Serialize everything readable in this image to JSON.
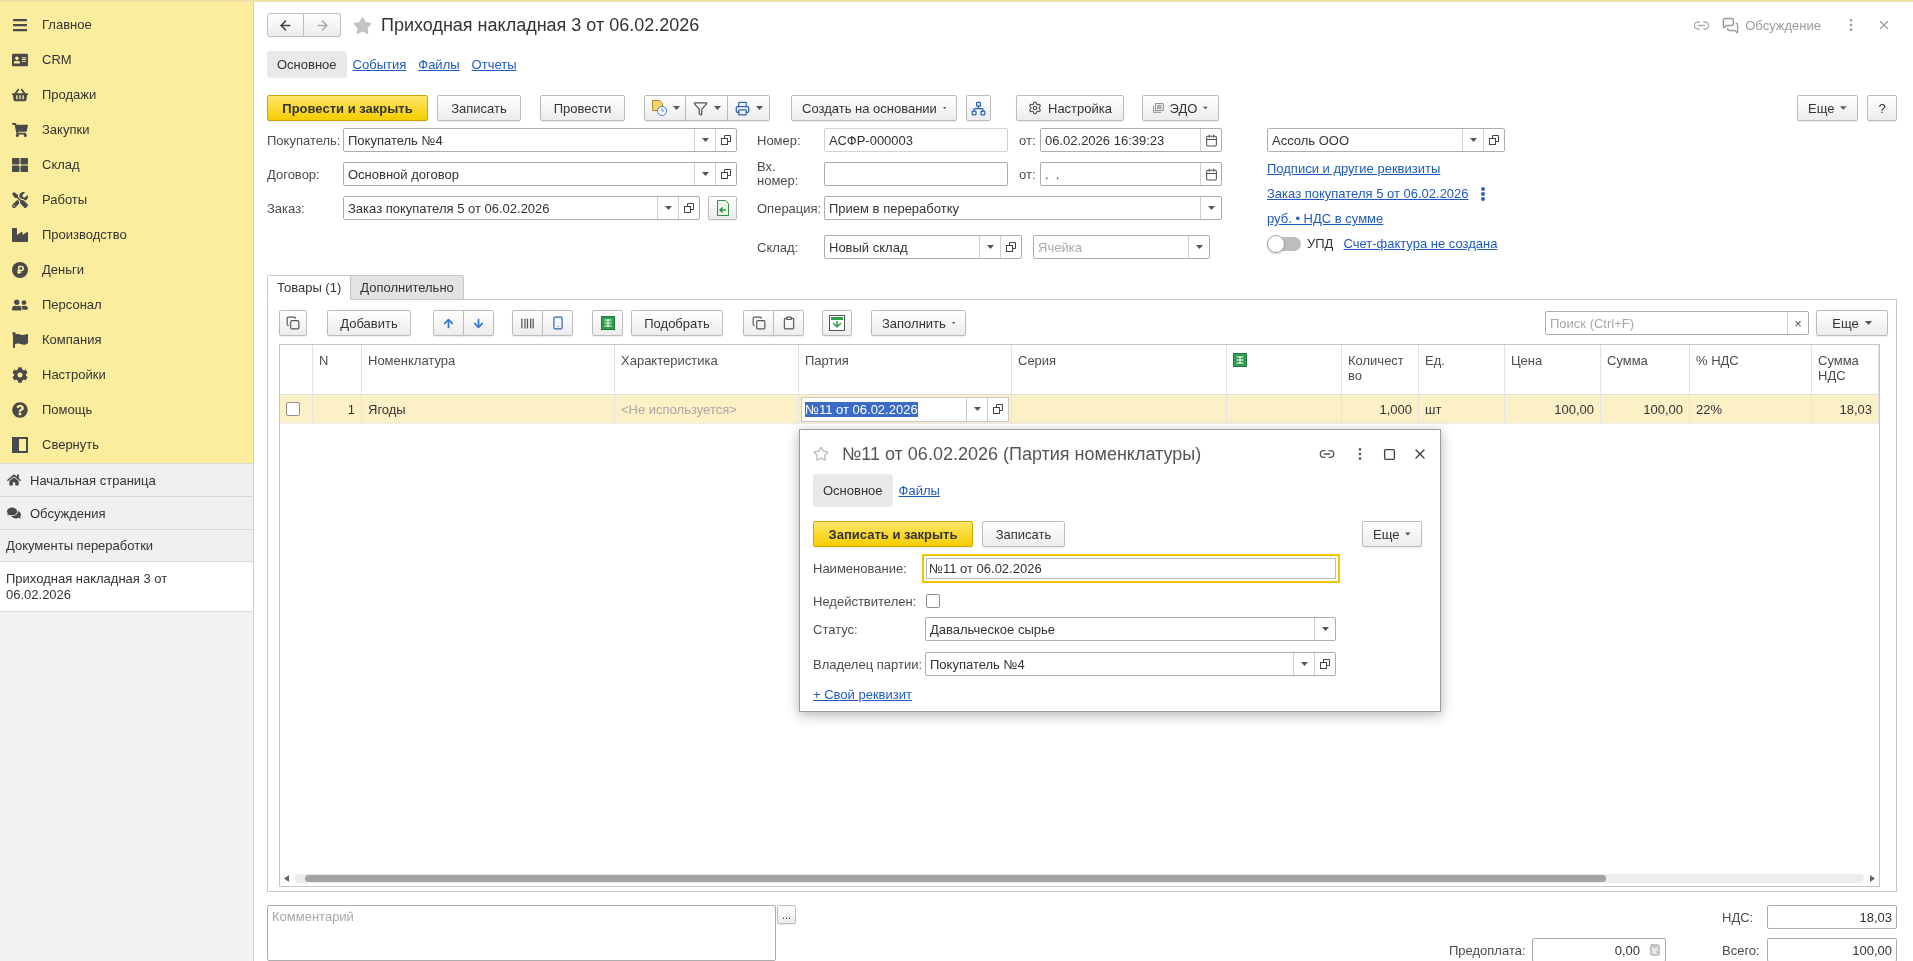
{
  "sidebar": {
    "sections": [
      {
        "label": "Главное"
      },
      {
        "label": "CRM"
      },
      {
        "label": "Продажи"
      },
      {
        "label": "Закупки"
      },
      {
        "label": "Склад"
      },
      {
        "label": "Работы"
      },
      {
        "label": "Производство"
      },
      {
        "label": "Деньги"
      },
      {
        "label": "Персонал"
      },
      {
        "label": "Компания"
      },
      {
        "label": "Настройки"
      },
      {
        "label": "Помощь"
      },
      {
        "label": "Свернуть"
      }
    ],
    "nav": [
      {
        "label": "Начальная страница"
      },
      {
        "label": "Обсуждения"
      }
    ],
    "open_windows": {
      "title": "Документы переработки",
      "items": [
        {
          "label": "Приходная накладная 3 от 06.02.2026",
          "selected": true
        }
      ]
    }
  },
  "document": {
    "title": "Приходная накладная 3 от 06.02.2026",
    "discussion": "Обсуждение",
    "tabs": [
      {
        "label": "Основное",
        "selected": true
      },
      {
        "label": "События",
        "selected": false
      },
      {
        "label": "Файлы",
        "selected": false
      },
      {
        "label": "Отчеты",
        "selected": false
      }
    ],
    "toolbar": {
      "post_and_close": "Провести и закрыть",
      "save": "Записать",
      "post": "Провести",
      "create_based_on": "Создать на основании",
      "settings": "Настройка",
      "edo": "ЭДО",
      "more": "Еще",
      "help": "?"
    },
    "fields": {
      "customer": {
        "label": "Покупатель:",
        "value": "Покупатель №4"
      },
      "contract": {
        "label": "Договор:",
        "value": "Основной договор"
      },
      "order": {
        "label": "Заказ:",
        "value": "Заказ покупателя 5 от 06.02.2026"
      },
      "number": {
        "label": "Номер:",
        "value": "АСФР-000003",
        "date_label": "от:",
        "date": "06.02.2026 16:39:23"
      },
      "incoming_number": {
        "label": "Вх. номер:",
        "date_label": "от:",
        "date": ".  ."
      },
      "operation": {
        "label": "Операция:",
        "value": "Прием в переработку"
      },
      "warehouse": {
        "label": "Склад:",
        "value": "Новый склад",
        "cell_placeholder": "Ячейка"
      },
      "organization": {
        "value": "Ассоль ООО"
      }
    },
    "links": {
      "signatures": "Подписи и другие реквизиты",
      "order": "Заказ покупателя 5 от 06.02.2026",
      "currency": "руб. • НДС в сумме"
    },
    "upd": {
      "label": "УПД",
      "on": false,
      "invoice_link": "Счет-фактура не создана"
    }
  },
  "goods": {
    "tabs": [
      {
        "label": "Товары (1)",
        "selected": true
      },
      {
        "label": "Дополнительно",
        "selected": false
      }
    ],
    "toolbar": {
      "add": "Добавить",
      "pick": "Подобрать",
      "fill": "Заполнить",
      "search_placeholder": "Поиск (Ctrl+F)",
      "clear": "×",
      "more": "Еще"
    },
    "columns": [
      {
        "label": "N",
        "kind": "number"
      },
      {
        "label": "Номенклатура",
        "kind": "text"
      },
      {
        "label": "Характеристика",
        "kind": "text"
      },
      {
        "label": "Партия",
        "kind": "text"
      },
      {
        "label": "Серия",
        "kind": "text"
      },
      {
        "kind": "icon"
      },
      {
        "label": "Количество",
        "kind": "number"
      },
      {
        "label": "Ед.",
        "kind": "text"
      },
      {
        "label": "Цена",
        "kind": "number"
      },
      {
        "label": "Сумма",
        "kind": "number"
      },
      {
        "label": "% НДС",
        "kind": "text"
      },
      {
        "label": "Сумма НДС",
        "kind": "number"
      }
    ],
    "rows": [
      {
        "selected": true,
        "checked": false,
        "cells": [
          "1",
          "Ягоды",
          {
            "text": "<Не используется>",
            "disabled": true
          },
          {
            "text": "№11 от 06.02.2026",
            "editing": true
          },
          null,
          null,
          "1,000",
          "шт",
          "100,00",
          "100,00",
          "22%",
          "18,03"
        ]
      }
    ]
  },
  "footer": {
    "comment_placeholder": "Комментарий",
    "comment_button": "...",
    "vat": {
      "label": "НДС:",
      "value": "18,03"
    },
    "prepayment": {
      "label": "Предоплата:",
      "value": "0,00"
    },
    "total": {
      "label": "Всего:",
      "value": "100,00"
    }
  },
  "batch_dialog": {
    "title": "№11 от 06.02.2026 (Партия номенклатуры)",
    "tabs": [
      {
        "label": "Основное",
        "selected": true
      },
      {
        "label": "Файлы",
        "selected": false
      }
    ],
    "buttons": {
      "save_and_close": "Записать и закрыть",
      "save": "Записать",
      "more": "Еще"
    },
    "fields": [
      {
        "kind": "text",
        "label": "Наименование:",
        "value": "№11 от 06.02.2026",
        "focused": true
      },
      {
        "kind": "checkbox",
        "label": "Недействителен:",
        "checked": false
      },
      {
        "kind": "select",
        "label": "Статус:",
        "value": "Давальческое сырье"
      },
      {
        "kind": "reference",
        "label": "Владелец партии:",
        "value": "Покупатель №4"
      }
    ],
    "add_attribute": "+ Свой реквизит"
  }
}
